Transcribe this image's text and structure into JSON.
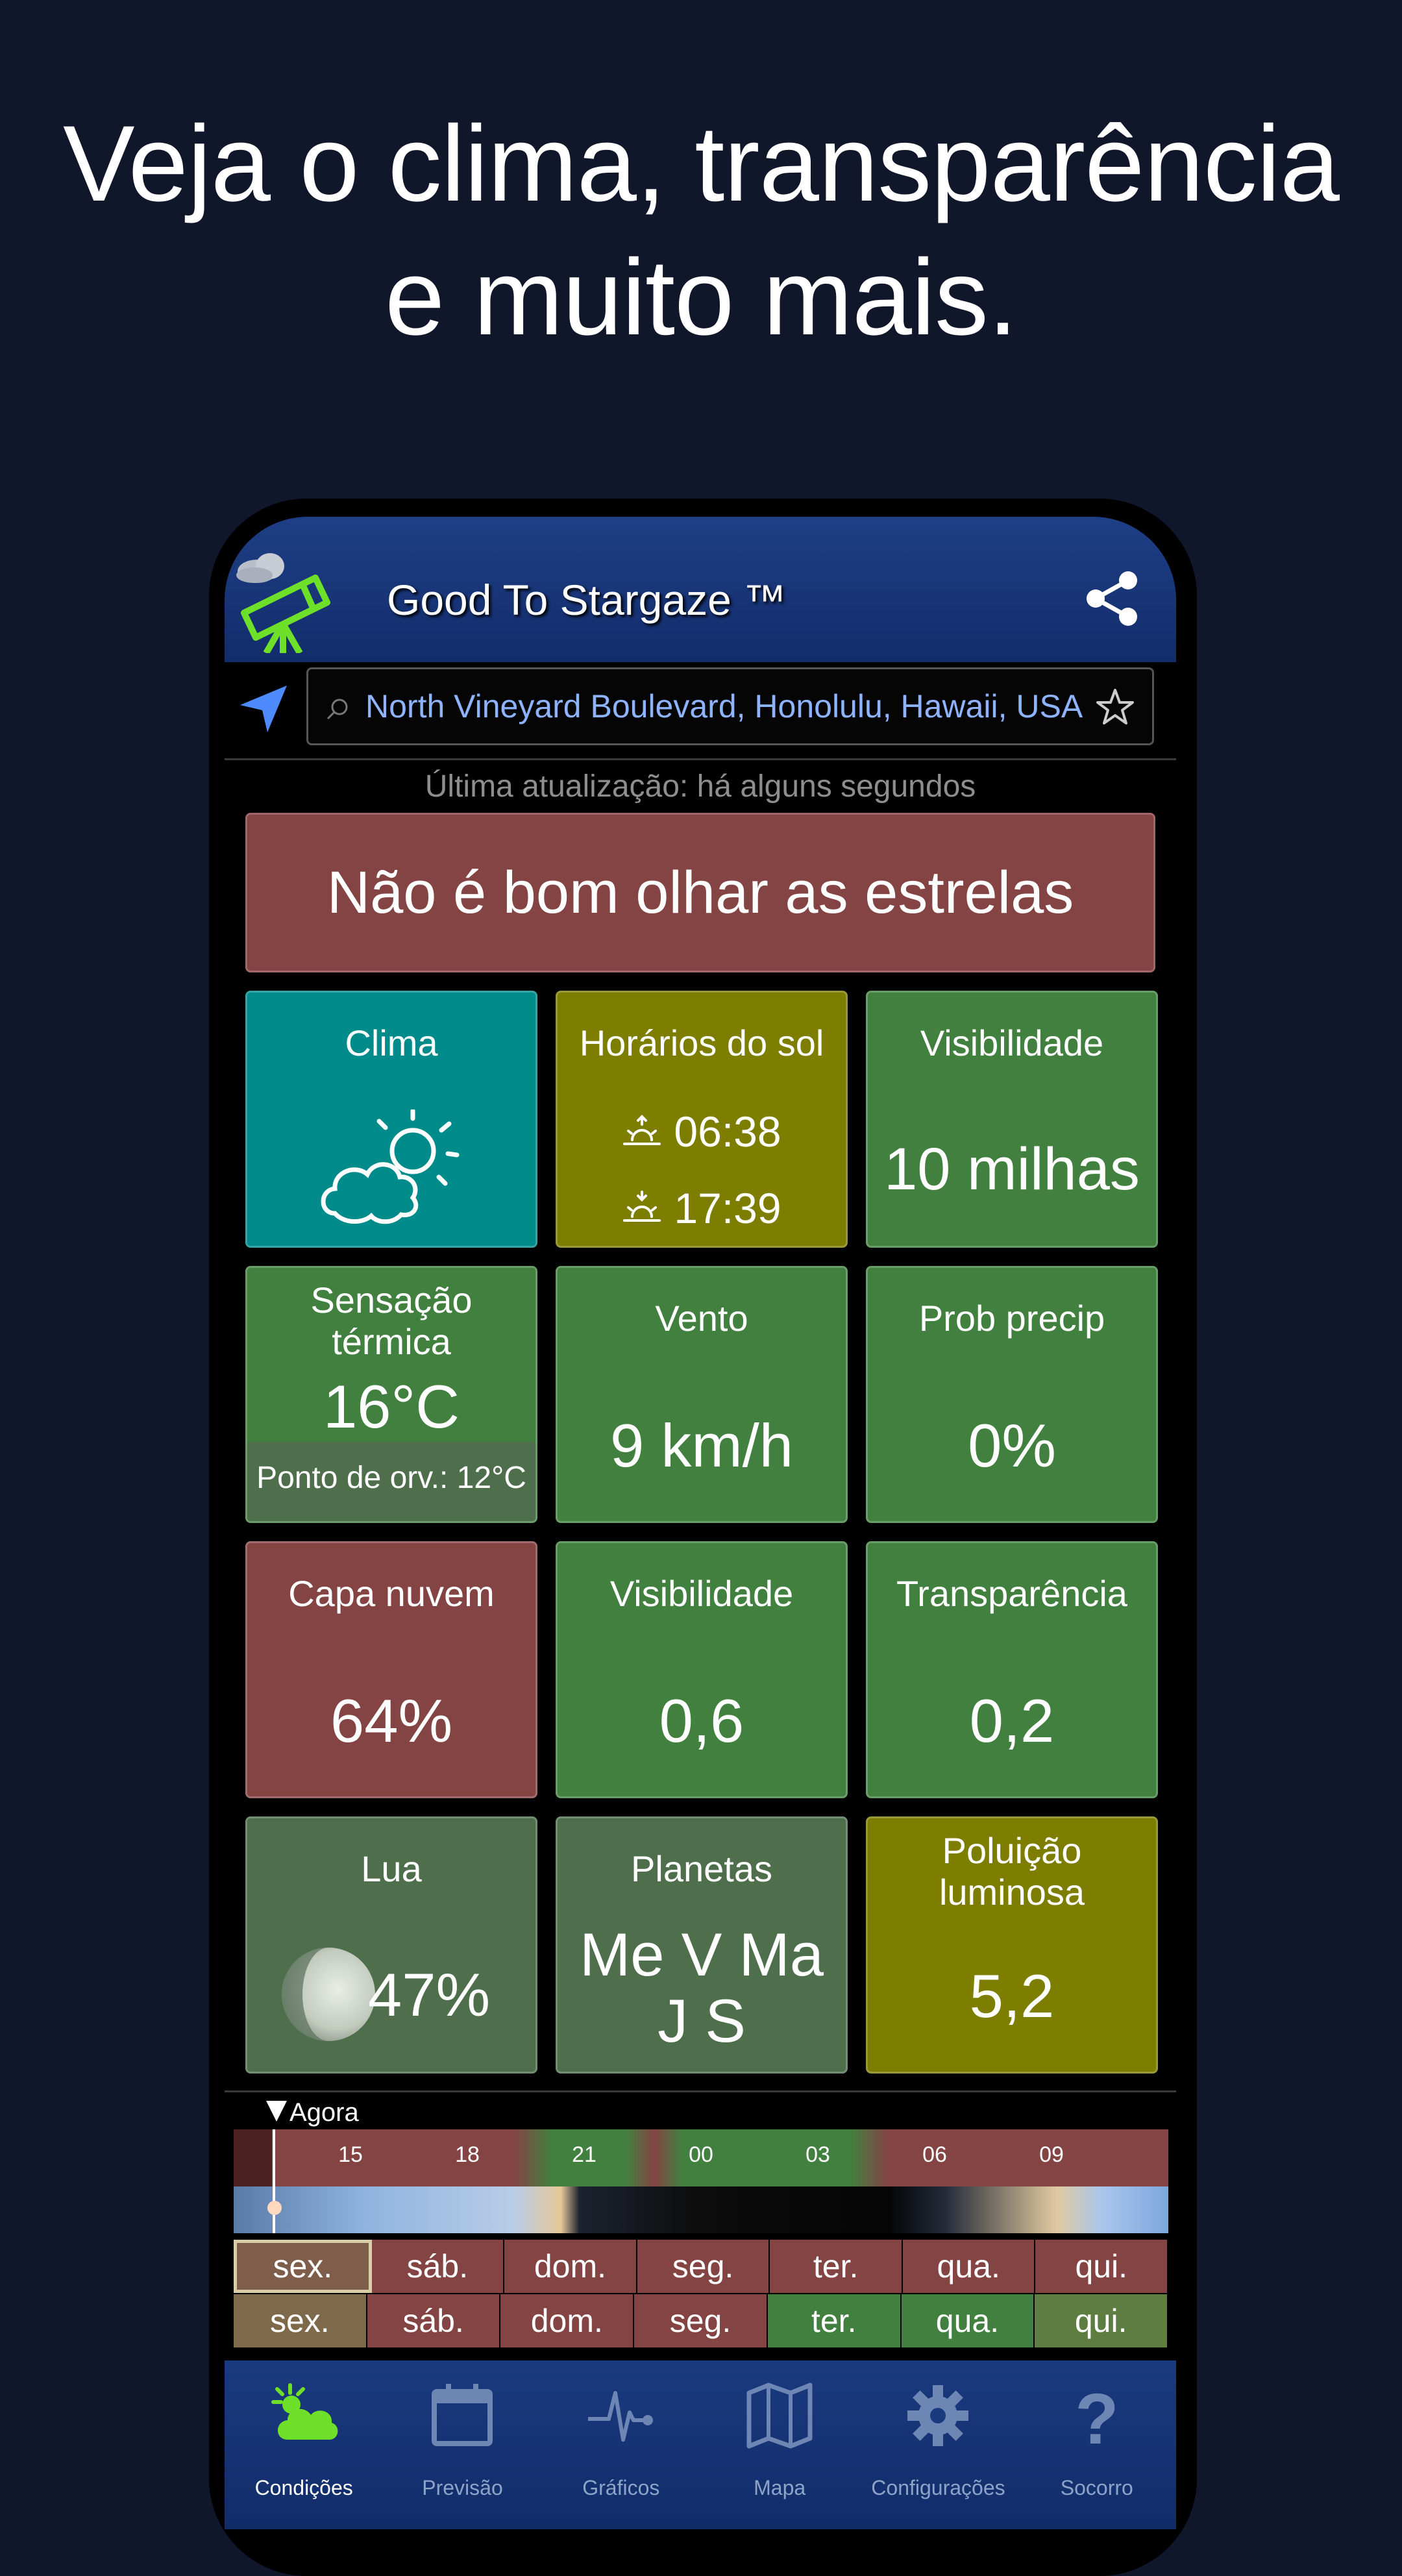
{
  "headline": {
    "line1": "Veja o clima, transparência",
    "line2": "e muito mais."
  },
  "app": {
    "title": "Good To Stargaze ™",
    "logo_icon": "telescope-cloud-icon",
    "share_icon": "share-icon"
  },
  "search": {
    "location": "North Vineyard Boulevard, Honolulu, Hawaii, USA",
    "locate_icon": "navigation-arrow-icon",
    "favorite_icon": "star-icon"
  },
  "status": {
    "last_update": "Última atualização: há alguns segundos"
  },
  "verdict": {
    "text": "Não é bom olhar as estrelas",
    "color": "#844444"
  },
  "tiles": {
    "weather": {
      "label": "Clima",
      "icon": "partly-cloudy-icon"
    },
    "sun": {
      "label": "Horários do sol",
      "sunrise": "06:38",
      "sunset": "17:39"
    },
    "visibility_miles": {
      "label": "Visibilidade",
      "value": "10 milhas"
    },
    "feels_like": {
      "label_line1": "Sensação",
      "label_line2": "térmica",
      "value": "16°C",
      "dew_point": "Ponto de orv.: 12°C"
    },
    "wind": {
      "label": "Vento",
      "value": "9 km/h"
    },
    "precip": {
      "label": "Prob precip",
      "value": "0%"
    },
    "cloud": {
      "label": "Capa nuvem",
      "value": "64%"
    },
    "seeing": {
      "label": "Visibilidade",
      "value": "0,6"
    },
    "transparency": {
      "label": "Transparência",
      "value": "0,2"
    },
    "moon": {
      "label": "Lua",
      "value": "47%",
      "illumination": 0.47
    },
    "planets": {
      "label": "Planetas",
      "line1": "Me V Ma",
      "line2": "J S"
    },
    "light_pollution": {
      "label_line1": "Poluição",
      "label_line2": "luminosa",
      "value": "5,2"
    }
  },
  "colors": {
    "good": "#42803f",
    "bad": "#844444",
    "fair": "#7d7d00",
    "weather": "#008b8b",
    "neutral": "#4f6f4c"
  },
  "timeline": {
    "now_label": "Agora",
    "hours": [
      "15",
      "18",
      "21",
      "00",
      "03",
      "06",
      "09"
    ]
  },
  "days_row1": [
    {
      "label": "sex.",
      "status": "bad",
      "selected": true
    },
    {
      "label": "sáb.",
      "status": "bad"
    },
    {
      "label": "dom.",
      "status": "bad"
    },
    {
      "label": "seg.",
      "status": "bad"
    },
    {
      "label": "ter.",
      "status": "bad"
    },
    {
      "label": "qua.",
      "status": "bad"
    },
    {
      "label": "qui.",
      "status": "bad"
    }
  ],
  "days_row2": [
    {
      "label": "sex.",
      "status": "tan"
    },
    {
      "label": "sáb.",
      "status": "bad"
    },
    {
      "label": "dom.",
      "status": "bad"
    },
    {
      "label": "seg.",
      "status": "bad"
    },
    {
      "label": "ter.",
      "status": "good"
    },
    {
      "label": "qua.",
      "status": "good"
    },
    {
      "label": "qui.",
      "status": "olivegreen"
    }
  ],
  "bottom_nav": [
    {
      "label": "Condições",
      "icon": "weather-conditions-icon",
      "active": true
    },
    {
      "label": "Previsão",
      "icon": "calendar-icon"
    },
    {
      "label": "Gráficos",
      "icon": "pulse-chart-icon"
    },
    {
      "label": "Mapa",
      "icon": "map-icon"
    },
    {
      "label": "Configurações",
      "icon": "gear-icon"
    },
    {
      "label": "Socorro",
      "icon": "question-mark-icon"
    }
  ]
}
